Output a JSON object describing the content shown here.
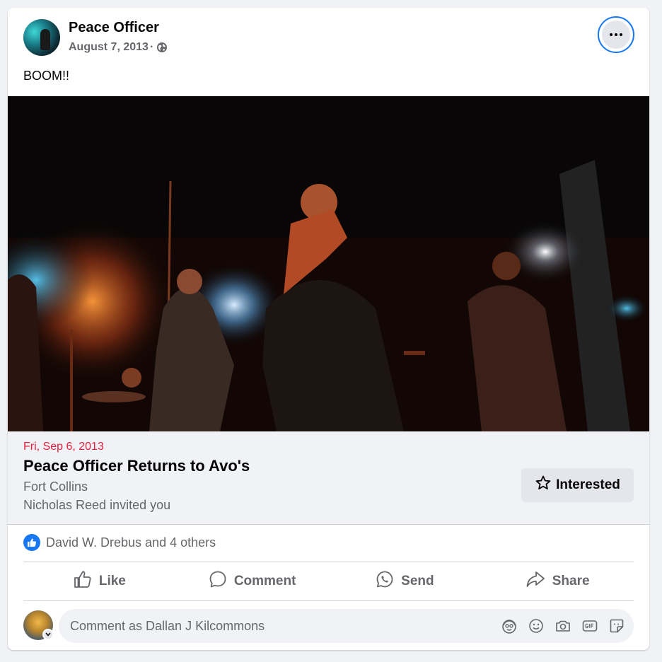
{
  "post": {
    "author": "Peace Officer",
    "date": "August 7, 2013",
    "date_separator": "·",
    "privacy_icon": "globe-icon",
    "text": "BOOM!!"
  },
  "event": {
    "date": "Fri, Sep 6, 2013",
    "title": "Peace Officer Returns to Avo's",
    "location": "Fort Collins",
    "invite": "Nicholas Reed invited you",
    "interested_label": "Interested"
  },
  "reactions": {
    "text": "David W. Drebus and 4 others",
    "icon": "like-reaction-icon"
  },
  "actions": {
    "like": "Like",
    "comment": "Comment",
    "send": "Send",
    "share": "Share"
  },
  "composer": {
    "placeholder": "Comment as Dallan J Kilcommons",
    "icons": [
      "avatar-sticker-icon",
      "emoji-icon",
      "camera-icon",
      "gif-icon",
      "sticker-icon"
    ]
  },
  "colors": {
    "accent": "#1877f2",
    "event_date": "#e41e3f",
    "secondary_text": "#65676b",
    "surface": "#f0f2f5"
  }
}
